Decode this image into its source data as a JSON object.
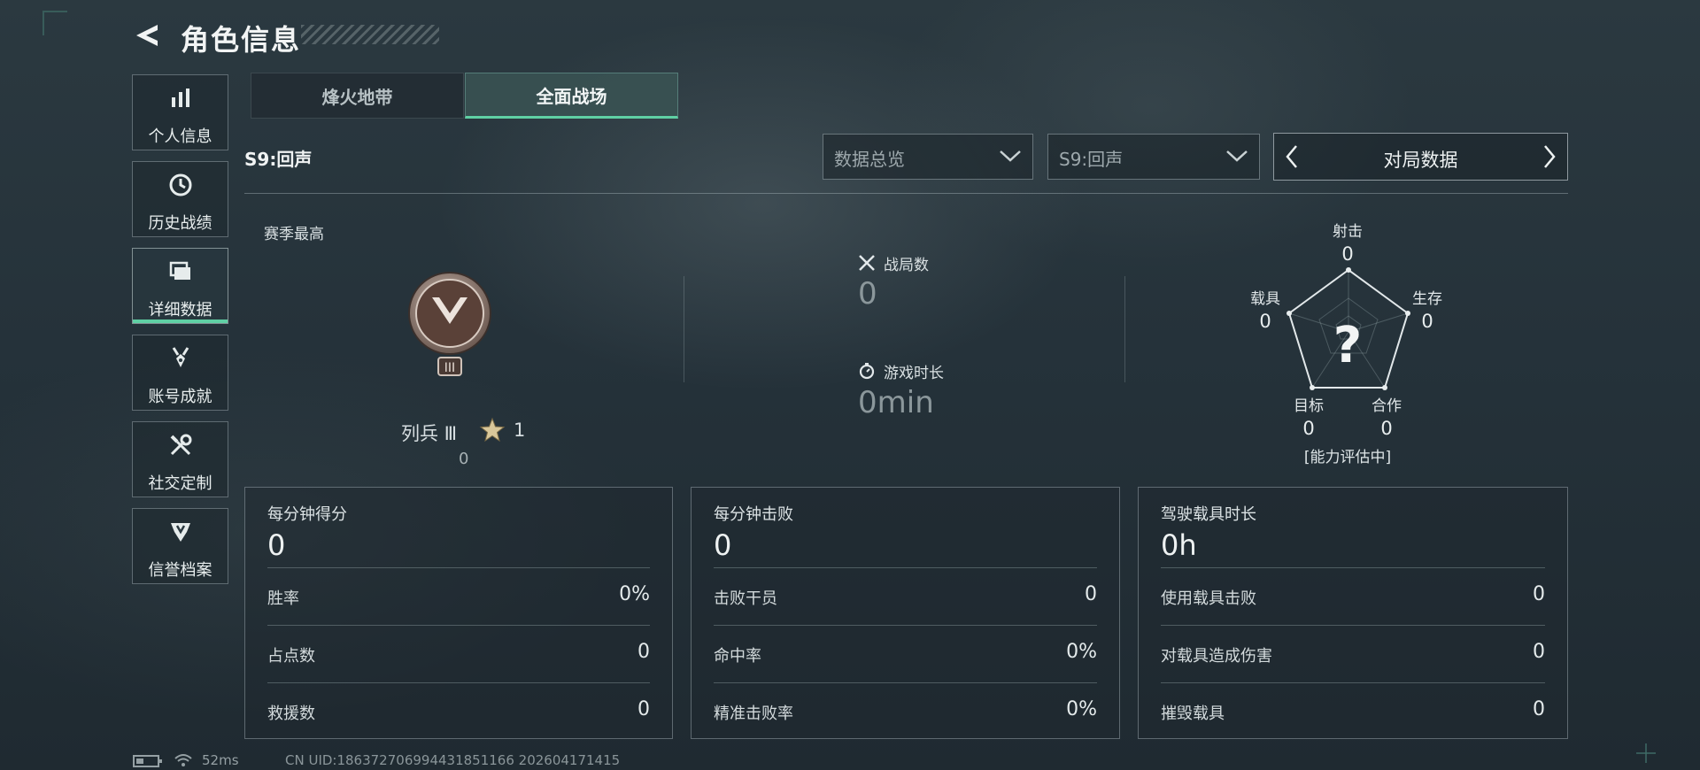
{
  "header": {
    "title": "角色信息"
  },
  "sidebar": {
    "items": [
      {
        "label": "个人信息",
        "icon": "bar-chart-icon"
      },
      {
        "label": "历史战绩",
        "icon": "clock-history-icon"
      },
      {
        "label": "详细数据",
        "icon": "folder-stack-icon",
        "active": true
      },
      {
        "label": "账号成就",
        "icon": "medal-icon"
      },
      {
        "label": "社交定制",
        "icon": "tools-icon"
      },
      {
        "label": "信誉档案",
        "icon": "shield-badge-icon"
      }
    ]
  },
  "tabs": [
    {
      "label": "烽火地带",
      "active": false
    },
    {
      "label": "全面战场",
      "active": true
    }
  ],
  "season_label": "S9:回声",
  "filters": {
    "overview": "数据总览",
    "season": "S9:回声",
    "mode": "对局数据"
  },
  "rank": {
    "section_label": "赛季最高",
    "name": "列兵 Ⅲ",
    "stars": "1",
    "points": "0"
  },
  "match_stats": {
    "battles_label": "战局数",
    "battles_value": "0",
    "playtime_label": "游戏时长",
    "playtime_value": "0min"
  },
  "radar": {
    "shooting": {
      "label": "射击",
      "value": "0"
    },
    "survival": {
      "label": "生存",
      "value": "0"
    },
    "teamwork": {
      "label": "合作",
      "value": "0"
    },
    "objective": {
      "label": "目标",
      "value": "0"
    },
    "vehicle": {
      "label": "载具",
      "value": "0"
    },
    "center_symbol": "?",
    "status": "[能力评估中]"
  },
  "panels": [
    {
      "header": "每分钟得分",
      "value": "0",
      "rows": [
        {
          "label": "胜率",
          "value": "0%"
        },
        {
          "label": "占点数",
          "value": "0"
        },
        {
          "label": "救援数",
          "value": "0"
        }
      ]
    },
    {
      "header": "每分钟击败",
      "value": "0",
      "rows": [
        {
          "label": "击败干员",
          "value": "0"
        },
        {
          "label": "命中率",
          "value": "0%"
        },
        {
          "label": "精准击败率",
          "value": "0%"
        }
      ]
    },
    {
      "header": "驾驶载具时长",
      "value": "0h",
      "rows": [
        {
          "label": "使用载具击败",
          "value": "0"
        },
        {
          "label": "对载具造成伤害",
          "value": "0"
        },
        {
          "label": "摧毁载具",
          "value": "0"
        }
      ]
    }
  ],
  "status_bar": {
    "ping": "52ms",
    "uid": "CN UID:186372706994431851166 202604171415"
  },
  "colors": {
    "accent": "#5fd0a4",
    "background": "#25323a"
  }
}
